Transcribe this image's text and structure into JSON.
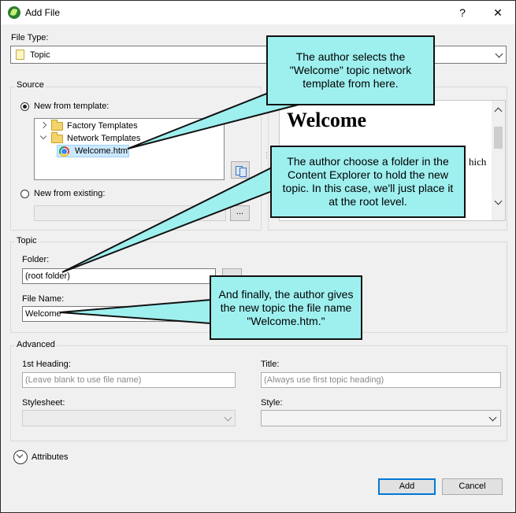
{
  "window": {
    "title": "Add File",
    "help_glyph": "?",
    "close_glyph": "✕"
  },
  "file_type": {
    "label": "File Type:",
    "value": "Topic"
  },
  "source": {
    "group_title": "Source",
    "new_from_template_label": "New from template:",
    "tree": [
      {
        "label": "Factory Templates",
        "expanded": false
      },
      {
        "label": "Network Templates",
        "expanded": true
      },
      {
        "label": "Welcome.htm",
        "selected": true
      }
    ],
    "new_from_existing_label": "New from existing:",
    "browse_label": "...",
    "preview_heading": "Welcome",
    "preview_fragment": "hich"
  },
  "topic": {
    "group_title": "Topic",
    "folder_label": "Folder:",
    "folder_value": "(root folder)",
    "file_name_label": "File Name:",
    "file_name_value": "Welcome"
  },
  "advanced": {
    "group_title": "Advanced",
    "first_heading_label": "1st Heading:",
    "first_heading_placeholder": "(Leave blank to use file name)",
    "title_label": "Title:",
    "title_placeholder": "(Always use first topic heading)",
    "stylesheet_label": "Stylesheet:",
    "style_label": "Style:"
  },
  "attributes": {
    "label": "Attributes"
  },
  "buttons": {
    "add": "Add",
    "cancel": "Cancel"
  },
  "callouts": {
    "template": "The author selects the \"Welcome\" topic network template from here.",
    "folder": "The author choose a folder in the Content Explorer to hold the new topic. In this case, we'll just place it at the root level.",
    "file_name": "And finally, the author gives the new topic the file name \"Welcome.htm.\""
  },
  "colors": {
    "callout_fill": "#9ef0ef",
    "accent": "#0078d7",
    "selection": "#cce8ff"
  }
}
